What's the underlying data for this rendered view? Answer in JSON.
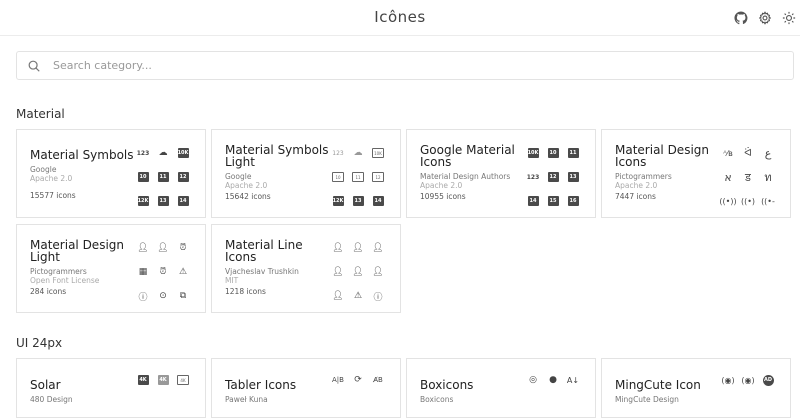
{
  "header": {
    "title": "Icônes",
    "icons": [
      "github-icon",
      "gear-icon",
      "sun-icon"
    ]
  },
  "search": {
    "placeholder": "Search category..."
  },
  "sections": [
    {
      "title": "Material",
      "cards": [
        {
          "name": "Material Symbols",
          "author": "Google",
          "license": "Apache 2.0",
          "count": "15577 icons"
        },
        {
          "name": "Material Symbols Light",
          "author": "Google",
          "license": "Apache 2.0",
          "count": "15642 icons"
        },
        {
          "name": "Google Material Icons",
          "author": "Material Design Authors",
          "license": "Apache 2.0",
          "count": "10955 icons"
        },
        {
          "name": "Material Design Icons",
          "author": "Pictogrammers",
          "license": "Apache 2.0",
          "count": "7447 icons"
        },
        {
          "name": "Material Design Light",
          "author": "Pictogrammers",
          "license": "Open Font License",
          "count": "284 icons"
        },
        {
          "name": "Material Line Icons",
          "author": "Vjacheslav Trushkin",
          "license": "MIT",
          "count": "1218 icons"
        }
      ]
    },
    {
      "title": "UI 24px",
      "cards": [
        {
          "name": "Solar",
          "author": "480 Design"
        },
        {
          "name": "Tabler Icons",
          "author": "Paweł Kuna"
        },
        {
          "name": "Boxicons",
          "author": "Boxicons"
        },
        {
          "name": "MingCute Icon",
          "author": "MingCute Design"
        }
      ]
    }
  ]
}
